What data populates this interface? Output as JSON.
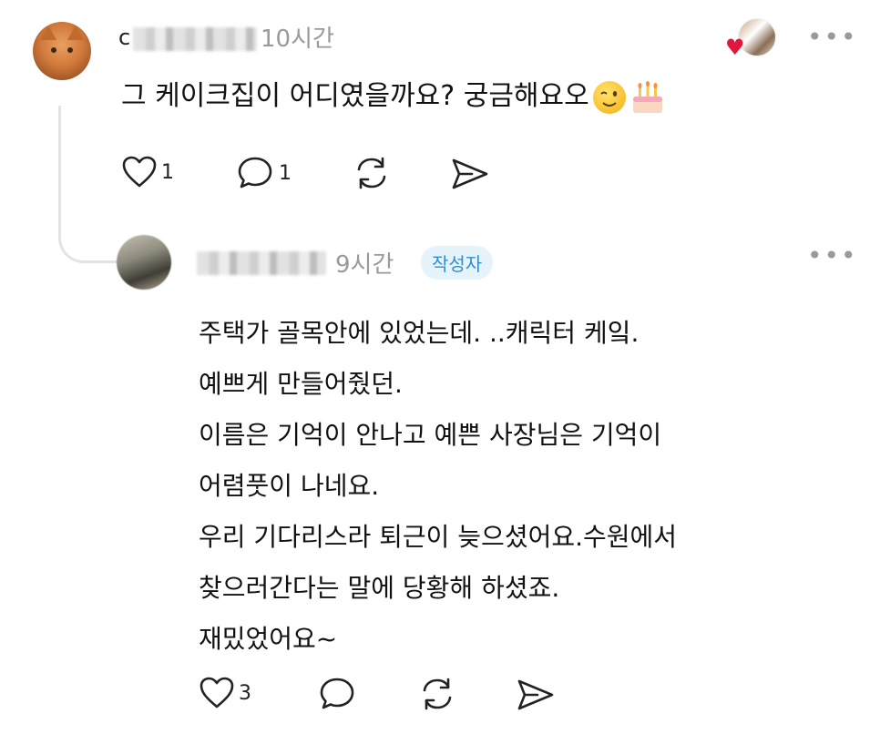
{
  "comment": {
    "username_visible": "c",
    "time": "10시간",
    "text": "그 케이크집이 어디였을까요? 궁금해요오",
    "emojis": [
      "winking-face",
      "birthday-cake"
    ],
    "like_count": "1",
    "reply_count": "1",
    "more_label": "•••"
  },
  "reply": {
    "time": "9시간",
    "author_badge": "작성자",
    "lines": [
      "주택가 골목안에 있었는데. ..캐릭터 케잌.",
      "예쁘게 만들어줬던.",
      "이름은 기억이 안나고 예쁜 사장님은 기억이",
      "어렴풋이 나네요.",
      "우리 기다리스라 퇴근이 늦으셨어요.수원에서",
      "찾으러간다는 말에 당황해 하셨죠.",
      "재밌었어요~"
    ],
    "like_count": "3",
    "more_label": "•••"
  },
  "colors": {
    "text": "#111111",
    "muted": "#9a9a9a",
    "badge_bg": "#e6f3fb",
    "badge_text": "#2d8fd3",
    "heart": "#e0163a"
  }
}
